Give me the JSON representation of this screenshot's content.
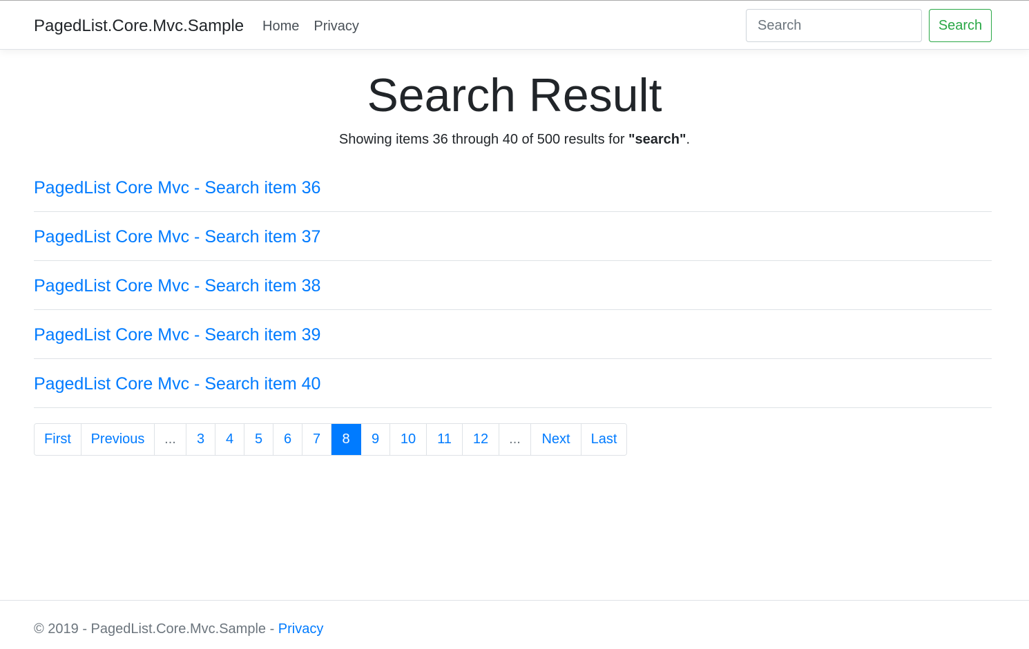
{
  "navbar": {
    "brand": "PagedList.Core.Mvc.Sample",
    "links": [
      {
        "label": "Home"
      },
      {
        "label": "Privacy"
      }
    ],
    "search": {
      "placeholder": "Search",
      "value": "",
      "button_label": "Search"
    }
  },
  "main": {
    "title": "Search Result",
    "summary": {
      "prefix": "Showing items 36 through 40 of 500 results for ",
      "query": "\"search\"",
      "suffix": "."
    },
    "results": [
      {
        "title": "PagedList Core Mvc - Search item 36"
      },
      {
        "title": "PagedList Core Mvc - Search item 37"
      },
      {
        "title": "PagedList Core Mvc - Search item 38"
      },
      {
        "title": "PagedList Core Mvc - Search item 39"
      },
      {
        "title": "PagedList Core Mvc - Search item 40"
      }
    ]
  },
  "pagination": {
    "first": "First",
    "previous": "Previous",
    "ellipsis": "...",
    "pages": [
      "3",
      "4",
      "5",
      "6",
      "7",
      "8",
      "9",
      "10",
      "11",
      "12"
    ],
    "current_page": "8",
    "next": "Next",
    "last": "Last"
  },
  "footer": {
    "copyright": "© 2019 - PagedList.Core.Mvc.Sample - ",
    "privacy_link": "Privacy"
  },
  "colors": {
    "link": "#007bff",
    "success": "#28a745",
    "muted": "#6c757d",
    "border": "#dee2e6"
  }
}
